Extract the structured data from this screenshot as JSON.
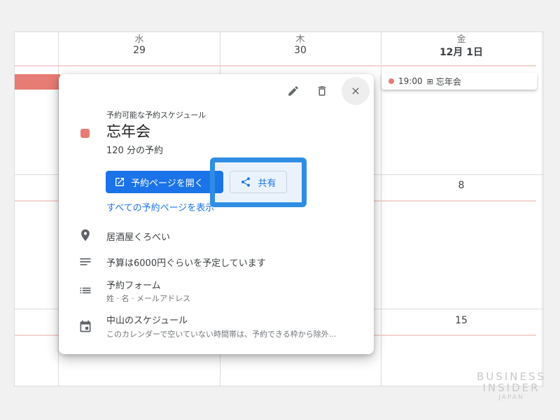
{
  "calendar": {
    "day_names": [
      "水",
      "木",
      "金"
    ],
    "dates": [
      "29",
      "30",
      "12月 1日"
    ],
    "week2_friday": "8",
    "week3_friday": "15",
    "event_chip": {
      "time": "19:00",
      "title": "忘年会"
    }
  },
  "popup": {
    "subtitle": "予約可能な予約スケジュール",
    "title": "忘年会",
    "duration": "120 分の予約",
    "open_button": "予約ページを開く",
    "share_button": "共有",
    "all_pages_link": "すべての予約ページを表示",
    "location": "居酒屋くろべい",
    "description": "予算は6000円ぐらいを予定しています",
    "form_title": "予約フォーム",
    "form_fields": "姓 · 名 · メールアドレス",
    "schedule_title": "中山のスケジュール",
    "schedule_desc": "このカレンダーで空いていない時間帯は、予約できる枠から除外...",
    "accent_color": "#e67c73",
    "primary_color": "#1a73e8",
    "icons": [
      "edit-icon",
      "delete-icon",
      "close-icon",
      "location-icon",
      "description-icon",
      "form-icon",
      "calendar-icon",
      "share-icon",
      "open-external-icon"
    ]
  },
  "brand": {
    "line1": "BUSINESS",
    "line2": "INSIDER",
    "line3": "JAPAN"
  }
}
